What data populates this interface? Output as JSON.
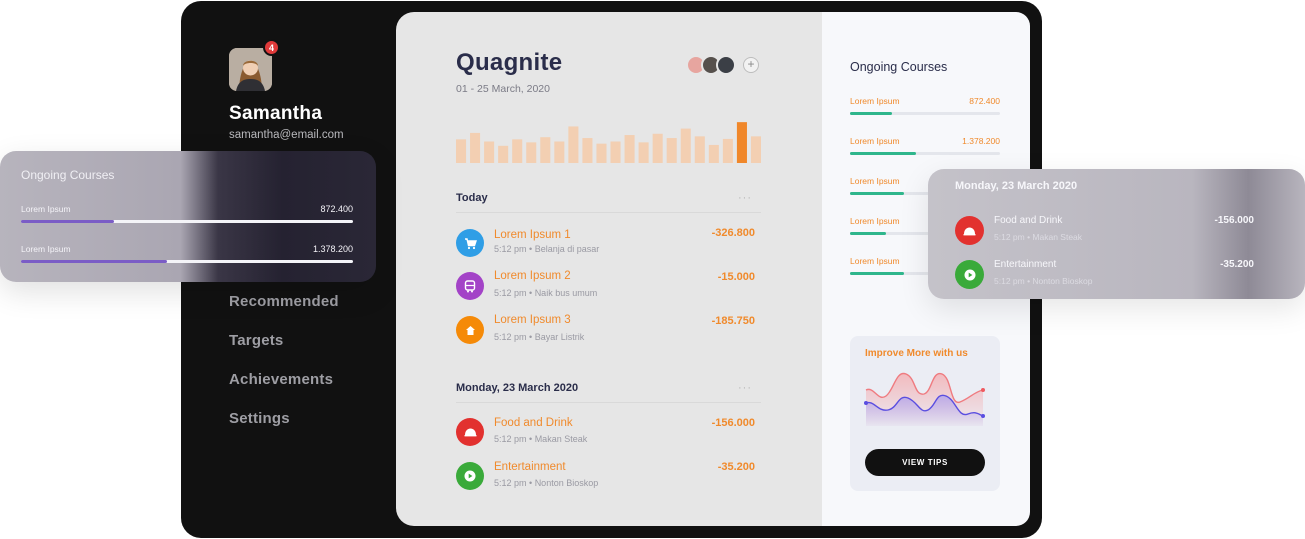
{
  "sidebar": {
    "notification_count": "4",
    "name": "Samantha",
    "email": "samantha@email.com",
    "nav": [
      "Recommended",
      "Targets",
      "Achievements",
      "Settings"
    ]
  },
  "main": {
    "title": "Quagnite",
    "date_range": "01 - 25 March, 2020",
    "more": "···",
    "add_member": "+",
    "activity_bars": [
      0.55,
      0.7,
      0.5,
      0.4,
      0.55,
      0.48,
      0.6,
      0.5,
      0.85,
      0.58,
      0.45,
      0.5,
      0.65,
      0.48,
      0.68,
      0.58,
      0.8,
      0.62,
      0.42,
      0.56,
      0.95,
      0.62
    ],
    "today": {
      "title": "Today",
      "items": [
        {
          "name": "Lorem Ipsum 1",
          "time": "5:12 pm",
          "desc": "Belanja di pasar",
          "amount": "-326.800",
          "color": "#2f9ee6",
          "icon": "cart-icon"
        },
        {
          "name": "Lorem Ipsum 2",
          "time": "5:12 pm",
          "desc": "Naik bus umum",
          "amount": "-15.000",
          "color": "#a343c7",
          "icon": "bus-icon"
        },
        {
          "name": "Lorem Ipsum 3",
          "time": "5:12 pm",
          "desc": "Bayar Listrik",
          "amount": "-185.750",
          "color": "#f58a08",
          "icon": "home-icon"
        }
      ]
    },
    "monday": {
      "title": "Monday, 23 March 2020",
      "items": [
        {
          "name": "Food and Drink",
          "time": "5:12 pm",
          "desc": "Makan Steak",
          "amount": "-156.000",
          "color": "#e2312f",
          "icon": "food-icon"
        },
        {
          "name": "Entertainment",
          "time": "5:12 pm",
          "desc": "Nonton Bioskop",
          "amount": "-35.200",
          "color": "#3aaa3a",
          "icon": "play-icon"
        }
      ]
    }
  },
  "right": {
    "title": "Ongoing Courses",
    "courses": [
      {
        "label": "Lorem Ipsum",
        "value": "872.400",
        "progress": 0.28
      },
      {
        "label": "Lorem Ipsum",
        "value": "1.378.200",
        "progress": 0.44
      },
      {
        "label": "Lorem Ipsum",
        "value": "",
        "progress": 0.36
      },
      {
        "label": "Lorem Ipsum",
        "value": "",
        "progress": 0.24
      },
      {
        "label": "Lorem Ipsum",
        "value": "",
        "progress": 0.36
      }
    ],
    "tips": {
      "title": "Improve More with us",
      "button": "VIEW TIPS"
    }
  },
  "float_courses": {
    "title": "Ongoing Courses",
    "items": [
      {
        "label": "Lorem Ipsum",
        "value": "872.400",
        "progress": 0.28
      },
      {
        "label": "Lorem Ipsum",
        "value": "1.378.200",
        "progress": 0.44
      }
    ]
  },
  "float_monday": {
    "title": "Monday, 23 March 2020",
    "items": [
      {
        "name": "Food and Drink",
        "meta": "5:12 pm  •  Makan Steak",
        "amount": "-156.000",
        "color": "#e2312f"
      },
      {
        "name": "Entertainment",
        "meta": "5:12 pm  •  Nonton Bioskop",
        "amount": "-35.200",
        "color": "#3aaa3a"
      }
    ]
  },
  "colors": {
    "accent_orange": "#f08a2c",
    "progress_green": "#2fb68c",
    "progress_purple": "#7b5dc6",
    "dark": "#111111"
  }
}
